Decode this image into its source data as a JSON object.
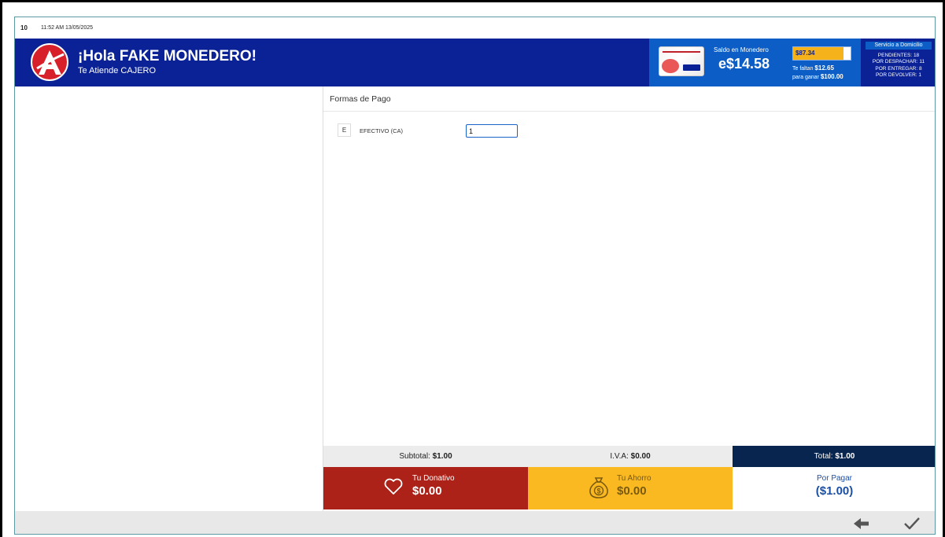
{
  "status_bar": {
    "station": "10",
    "datetime": "11:52 AM 13/05/2025"
  },
  "header": {
    "greeting": "¡Hola FAKE MONEDERO!",
    "cashier": "Te Atiende CAJERO",
    "logo_icon": "ahorro-a-logo"
  },
  "wallet": {
    "label": "Saldo en Monedero",
    "amount": "e$14.58",
    "progress_value": "$87.34",
    "progress_fraction": 0.8734,
    "missing_prefix": "Te faltan",
    "missing_amount": "$12.65",
    "goal_prefix": "para ganar",
    "goal_amount": "$100.00"
  },
  "delivery": {
    "title": "Servicio a Domicilio",
    "pending": "PENDIENTES: 18",
    "to_dispatch": "POR DESPACHAR: 11",
    "to_deliver": "POR ENTREGAR: 8",
    "to_return": "POR DEVOLVER: 1"
  },
  "payments": {
    "title": "Formas de Pago",
    "methods": [
      {
        "key": "E",
        "name": "EFECTIVO (CA)",
        "value": "1"
      }
    ]
  },
  "totals": {
    "subtotal_label": "Subtotal:",
    "subtotal_value": "$1.00",
    "iva_label": "I.V.A:",
    "iva_value": "$0.00",
    "total_label": "Total:",
    "total_value": "$1.00"
  },
  "summary": {
    "donation_label": "Tu Donativo",
    "donation_value": "$0.00",
    "donation_icon": "heart-icon",
    "savings_label": "Tu Ahorro",
    "savings_value": "$0.00",
    "savings_icon": "money-bag-icon",
    "due_label": "Por Pagar",
    "due_value": "($1.00)"
  },
  "actions": {
    "back_icon": "arrow-left-icon",
    "confirm_icon": "checkmark-icon"
  },
  "colors": {
    "header_blue": "#0a2296",
    "wallet_blue": "#0c5ec6",
    "total_navy": "#08254f",
    "donation_red": "#ac2118",
    "savings_yellow": "#fbb921",
    "accent_red": "#d8202a"
  }
}
